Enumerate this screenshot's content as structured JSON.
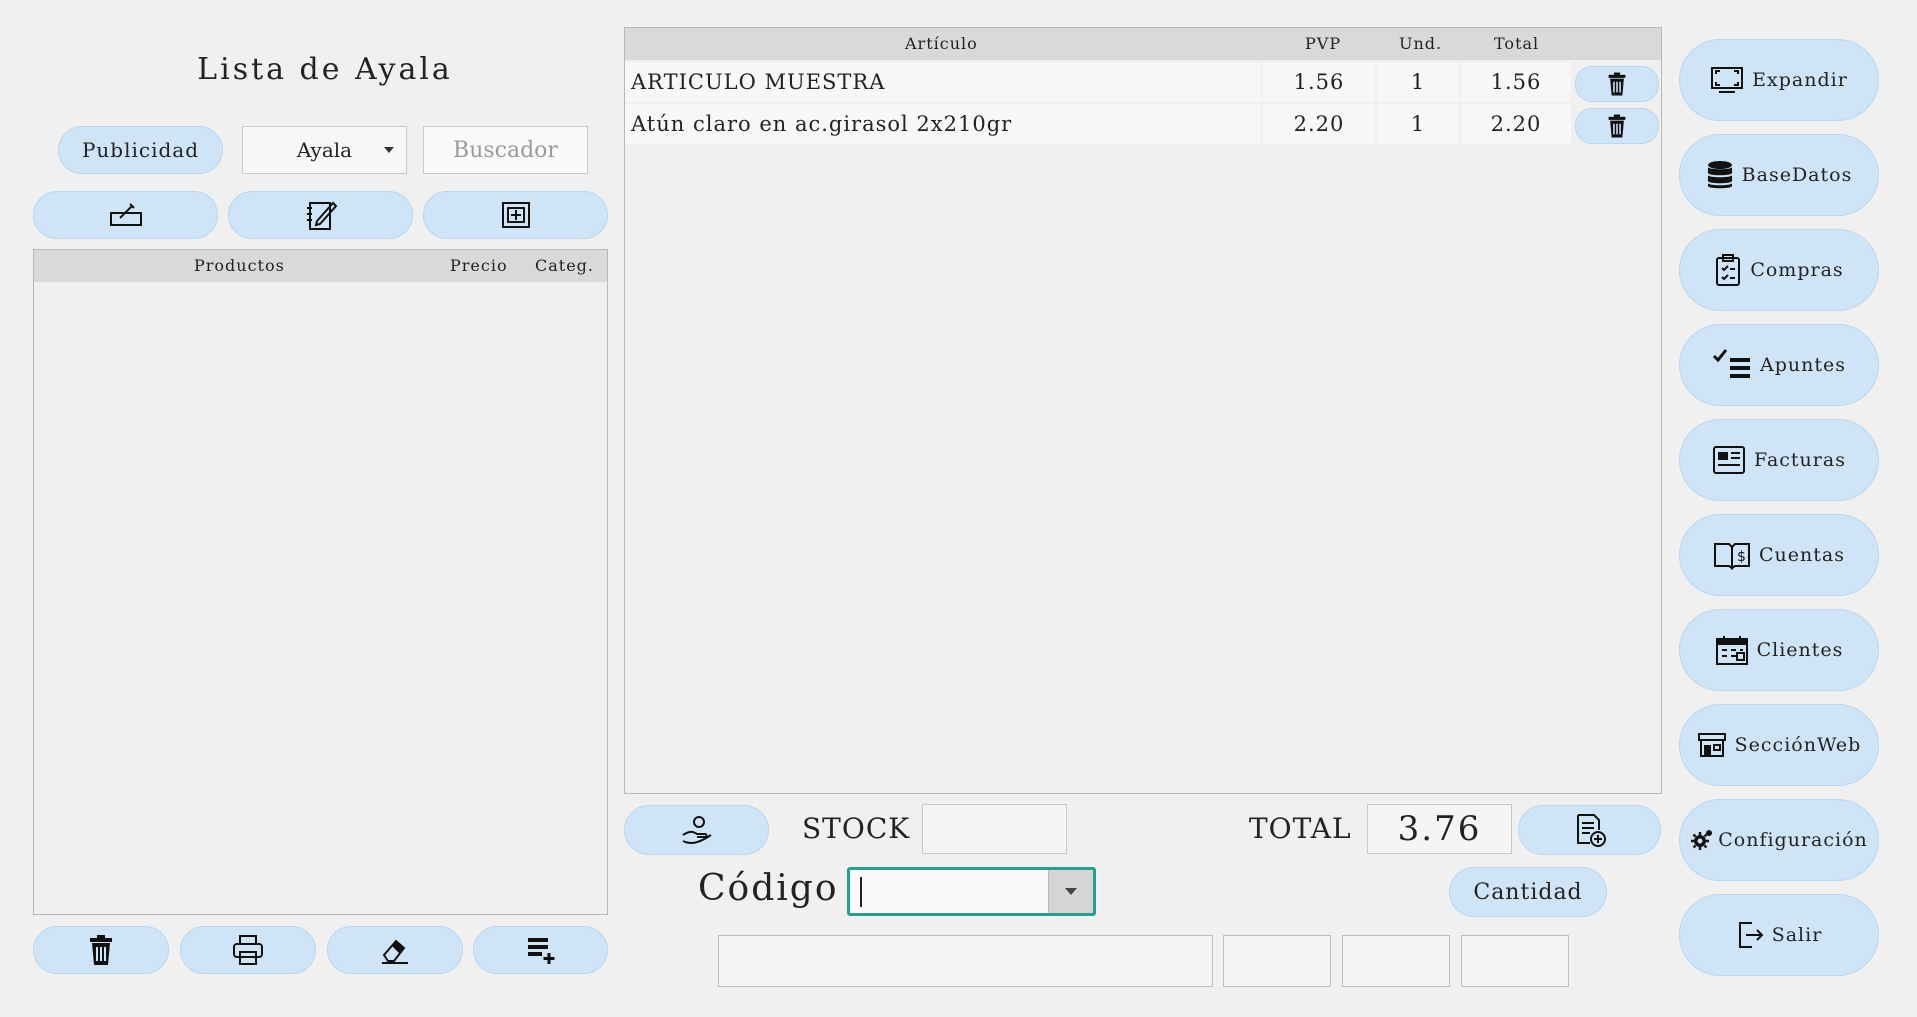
{
  "left_panel": {
    "title": "Lista de Ayala",
    "publicidad_label": "Publicidad",
    "list_selector": {
      "selected": "Ayala"
    },
    "search": {
      "placeholder": "Buscador",
      "value": ""
    },
    "tool_icons": [
      "edit-sign-icon",
      "notebook-edit-icon",
      "add-box-icon"
    ],
    "products_table": {
      "columns": [
        "Productos",
        "Precio",
        "Categ."
      ],
      "rows": []
    },
    "bottom_icons": [
      "trash-icon",
      "printer-icon",
      "eraser-icon",
      "list-add-icon"
    ]
  },
  "cart_table": {
    "columns": [
      "Artículo",
      "PVP",
      "Und.",
      "Total"
    ],
    "rows": [
      {
        "articulo": "ARTICULO MUESTRA",
        "pvp": "1.56",
        "und": "1",
        "total": "1.56"
      },
      {
        "articulo": "Atún claro en ac.girasol 2x210gr",
        "pvp": "2.20",
        "und": "1",
        "total": "2.20"
      }
    ]
  },
  "bottom": {
    "stock_label": "STOCK",
    "stock_value": "",
    "total_label": "TOTAL",
    "total_value": "3.76",
    "codigo_label": "Código",
    "codigo_value": "",
    "cantidad_label": "Cantidad"
  },
  "nav": [
    {
      "label": "Expandir",
      "icon": "monitor-expand-icon"
    },
    {
      "label": "BaseDatos",
      "icon": "database-icon"
    },
    {
      "label": "Compras",
      "icon": "clipboard-checklist-icon"
    },
    {
      "label": "Apuntes",
      "icon": "checklist-icon"
    },
    {
      "label": "Facturas",
      "icon": "invoice-icon"
    },
    {
      "label": "Cuentas",
      "icon": "book-dollar-icon"
    },
    {
      "label": "Clientes",
      "icon": "calendar-icon"
    },
    {
      "label": "SecciónWeb",
      "icon": "storefront-icon"
    },
    {
      "label": "Configuración",
      "icon": "gears-icon"
    },
    {
      "label": "Salir",
      "icon": "exit-icon"
    }
  ],
  "colors": {
    "background": "#f0f0f0",
    "button": "#cfe5f7",
    "table_header": "#d9d9d9",
    "focus_border": "#2a9d8f"
  }
}
